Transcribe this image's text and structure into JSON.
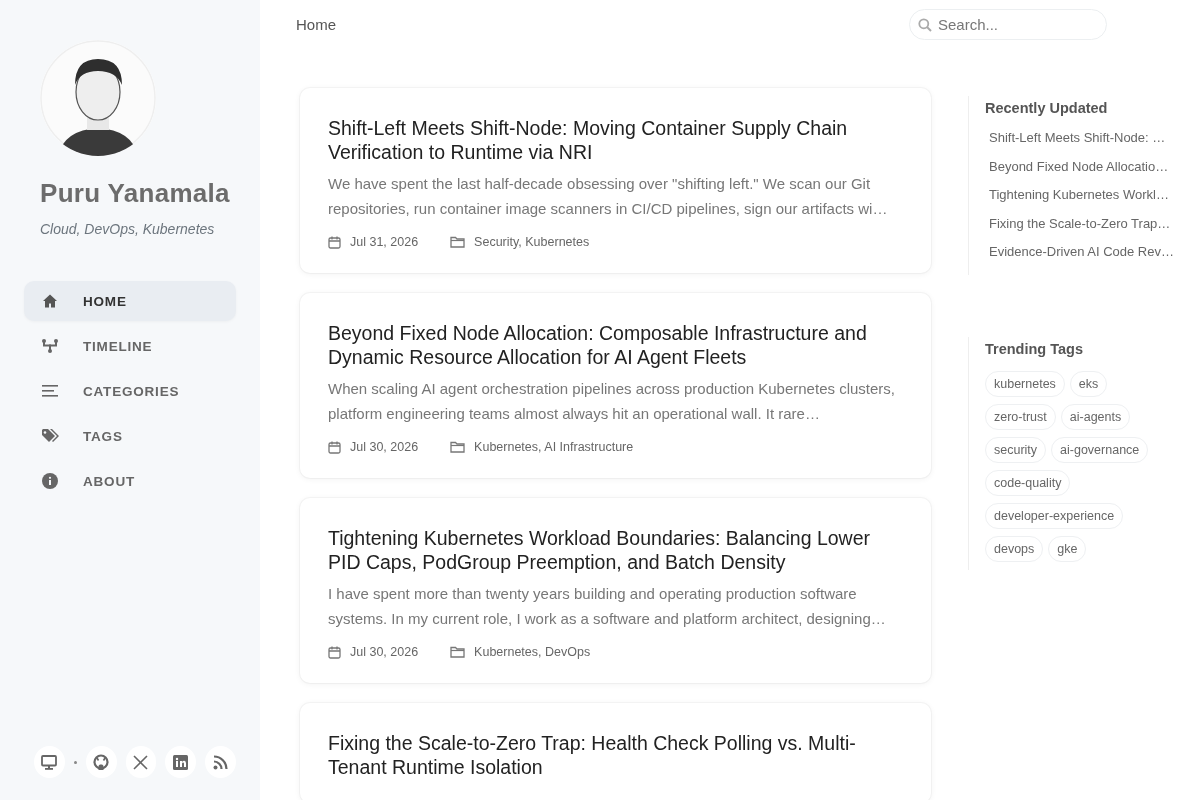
{
  "sidebar": {
    "site_title": "Puru Yanamala",
    "subtitle": "Cloud, DevOps, Kubernetes",
    "nav": [
      {
        "label": "HOME",
        "selected": true
      },
      {
        "label": "TIMELINE",
        "selected": false
      },
      {
        "label": "CATEGORIES",
        "selected": false
      },
      {
        "label": "TAGS",
        "selected": false
      },
      {
        "label": "ABOUT",
        "selected": false
      }
    ]
  },
  "topbar": {
    "breadcrumb": "Home",
    "search": {
      "placeholder": "Search..."
    }
  },
  "posts": [
    {
      "title": "Shift-Left Meets Shift-Node: Moving Container Supply Chain Verification to Runtime via NRI",
      "excerpt": "We have spent the last half-decade obsessing over \"shifting left.\" We scan our Git repositories, run container image scanners in CI/CD pipelines, sign our artifacts wi…",
      "date": "Jul 31, 2026",
      "categories": "Security, Kubernetes"
    },
    {
      "title": "Beyond Fixed Node Allocation: Composable Infrastructure and Dynamic Resource Allocation for AI Agent Fleets",
      "excerpt": "When scaling AI agent orchestration pipelines across production Kubernetes clusters, platform engineering teams almost always hit an operational wall. It rare…",
      "date": "Jul 30, 2026",
      "categories": "Kubernetes, AI Infrastructure"
    },
    {
      "title": "Tightening Kubernetes Workload Boundaries: Balancing Lower PID Caps, PodGroup Preemption, and Batch Density",
      "excerpt": "I have spent more than twenty years building and operating production software systems. In my current role, I work as a software and platform architect, designing…",
      "date": "Jul 30, 2026",
      "categories": "Kubernetes, DevOps"
    },
    {
      "title": "Fixing the Scale-to-Zero Trap: Health Check Polling vs. Multi-Tenant Runtime Isolation"
    }
  ],
  "panel": {
    "recent_title": "Recently Updated",
    "recent": [
      "Shift-Left Meets Shift-Node: …",
      "Beyond Fixed Node Allocatio…",
      "Tightening Kubernetes Workl…",
      "Fixing the Scale-to-Zero Trap…",
      "Evidence-Driven AI Code Rev…"
    ],
    "tags_title": "Trending Tags",
    "tags": [
      "kubernetes",
      "eks",
      "zero-trust",
      "ai-agents",
      "security",
      "ai-governance",
      "code-quality",
      "developer-experience",
      "devops",
      "gke"
    ]
  }
}
